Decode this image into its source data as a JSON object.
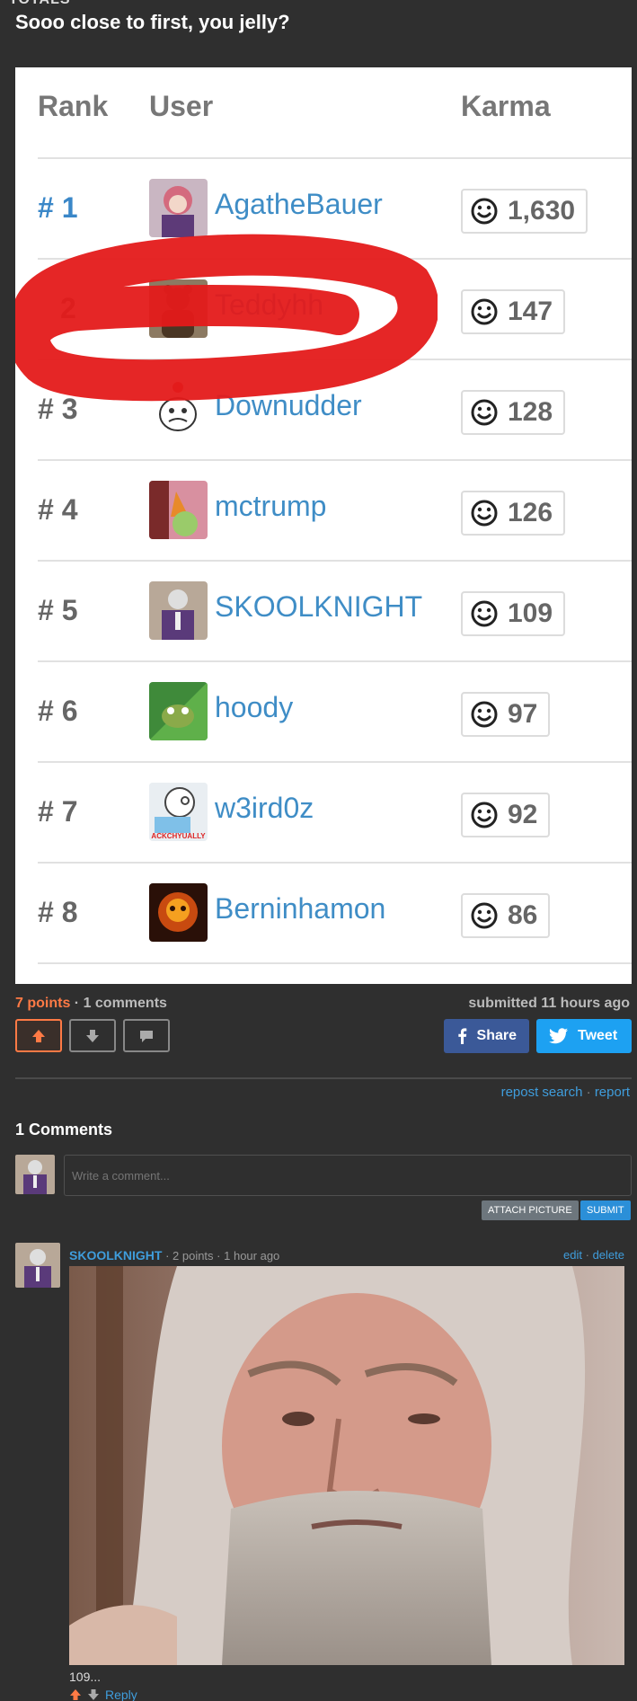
{
  "page": {
    "top_cut_text": "TOTALS",
    "post_title": "Sooo close to first, you jelly?"
  },
  "leaderboard": {
    "headers": {
      "rank": "Rank",
      "user": "User",
      "karma": "Karma"
    },
    "rows": [
      {
        "rank": "# 1",
        "user": "AgatheBauer",
        "karma": "1,630"
      },
      {
        "rank": "2",
        "user": "Teddyhh",
        "karma": "147"
      },
      {
        "rank": "# 3",
        "user": "Downudder",
        "karma": "128"
      },
      {
        "rank": "# 4",
        "user": "mctrump",
        "karma": "126"
      },
      {
        "rank": "# 5",
        "user": "SKOOLKNIGHT",
        "karma": "109"
      },
      {
        "rank": "# 6",
        "user": "hoody",
        "karma": "97"
      },
      {
        "rank": "# 7",
        "user": "w3ird0z",
        "karma": "92"
      },
      {
        "rank": "# 8",
        "user": "Berninhamon",
        "karma": "86"
      }
    ],
    "avatar_label_w3ird0z": "ACKCHYUALLY",
    "scribble_color": "#e41a1a"
  },
  "post": {
    "points": "7 points",
    "separator": " · ",
    "comments_count": "1 comments",
    "submitted": "submitted 11 hours ago",
    "share_label": "Share",
    "tweet_label": "Tweet",
    "repost_search": "repost search",
    "report": "report",
    "accent": "#ff7a45"
  },
  "comments": {
    "title": "1 Comments",
    "placeholder": "Write a comment...",
    "attach_label": "ATTACH PICTURE",
    "submit_label": "SUBMIT",
    "items": [
      {
        "user": "SKOOLKNIGHT",
        "points": "2 points",
        "time": "1 hour ago",
        "edit": "edit",
        "delete": "delete",
        "text": "109...",
        "reply": "Reply"
      }
    ]
  }
}
